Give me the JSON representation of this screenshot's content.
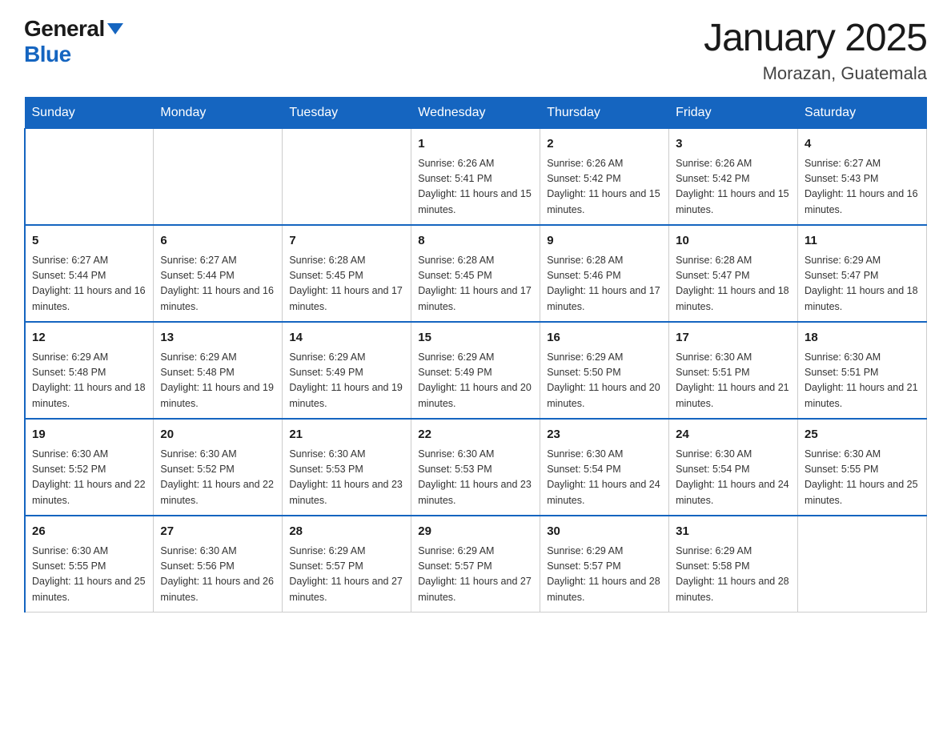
{
  "logo": {
    "general": "General",
    "blue": "Blue"
  },
  "title": "January 2025",
  "location": "Morazan, Guatemala",
  "days_of_week": [
    "Sunday",
    "Monday",
    "Tuesday",
    "Wednesday",
    "Thursday",
    "Friday",
    "Saturday"
  ],
  "weeks": [
    [
      {
        "day": "",
        "sunrise": "",
        "sunset": "",
        "daylight": ""
      },
      {
        "day": "",
        "sunrise": "",
        "sunset": "",
        "daylight": ""
      },
      {
        "day": "",
        "sunrise": "",
        "sunset": "",
        "daylight": ""
      },
      {
        "day": "1",
        "sunrise": "Sunrise: 6:26 AM",
        "sunset": "Sunset: 5:41 PM",
        "daylight": "Daylight: 11 hours and 15 minutes."
      },
      {
        "day": "2",
        "sunrise": "Sunrise: 6:26 AM",
        "sunset": "Sunset: 5:42 PM",
        "daylight": "Daylight: 11 hours and 15 minutes."
      },
      {
        "day": "3",
        "sunrise": "Sunrise: 6:26 AM",
        "sunset": "Sunset: 5:42 PM",
        "daylight": "Daylight: 11 hours and 15 minutes."
      },
      {
        "day": "4",
        "sunrise": "Sunrise: 6:27 AM",
        "sunset": "Sunset: 5:43 PM",
        "daylight": "Daylight: 11 hours and 16 minutes."
      }
    ],
    [
      {
        "day": "5",
        "sunrise": "Sunrise: 6:27 AM",
        "sunset": "Sunset: 5:44 PM",
        "daylight": "Daylight: 11 hours and 16 minutes."
      },
      {
        "day": "6",
        "sunrise": "Sunrise: 6:27 AM",
        "sunset": "Sunset: 5:44 PM",
        "daylight": "Daylight: 11 hours and 16 minutes."
      },
      {
        "day": "7",
        "sunrise": "Sunrise: 6:28 AM",
        "sunset": "Sunset: 5:45 PM",
        "daylight": "Daylight: 11 hours and 17 minutes."
      },
      {
        "day": "8",
        "sunrise": "Sunrise: 6:28 AM",
        "sunset": "Sunset: 5:45 PM",
        "daylight": "Daylight: 11 hours and 17 minutes."
      },
      {
        "day": "9",
        "sunrise": "Sunrise: 6:28 AM",
        "sunset": "Sunset: 5:46 PM",
        "daylight": "Daylight: 11 hours and 17 minutes."
      },
      {
        "day": "10",
        "sunrise": "Sunrise: 6:28 AM",
        "sunset": "Sunset: 5:47 PM",
        "daylight": "Daylight: 11 hours and 18 minutes."
      },
      {
        "day": "11",
        "sunrise": "Sunrise: 6:29 AM",
        "sunset": "Sunset: 5:47 PM",
        "daylight": "Daylight: 11 hours and 18 minutes."
      }
    ],
    [
      {
        "day": "12",
        "sunrise": "Sunrise: 6:29 AM",
        "sunset": "Sunset: 5:48 PM",
        "daylight": "Daylight: 11 hours and 18 minutes."
      },
      {
        "day": "13",
        "sunrise": "Sunrise: 6:29 AM",
        "sunset": "Sunset: 5:48 PM",
        "daylight": "Daylight: 11 hours and 19 minutes."
      },
      {
        "day": "14",
        "sunrise": "Sunrise: 6:29 AM",
        "sunset": "Sunset: 5:49 PM",
        "daylight": "Daylight: 11 hours and 19 minutes."
      },
      {
        "day": "15",
        "sunrise": "Sunrise: 6:29 AM",
        "sunset": "Sunset: 5:49 PM",
        "daylight": "Daylight: 11 hours and 20 minutes."
      },
      {
        "day": "16",
        "sunrise": "Sunrise: 6:29 AM",
        "sunset": "Sunset: 5:50 PM",
        "daylight": "Daylight: 11 hours and 20 minutes."
      },
      {
        "day": "17",
        "sunrise": "Sunrise: 6:30 AM",
        "sunset": "Sunset: 5:51 PM",
        "daylight": "Daylight: 11 hours and 21 minutes."
      },
      {
        "day": "18",
        "sunrise": "Sunrise: 6:30 AM",
        "sunset": "Sunset: 5:51 PM",
        "daylight": "Daylight: 11 hours and 21 minutes."
      }
    ],
    [
      {
        "day": "19",
        "sunrise": "Sunrise: 6:30 AM",
        "sunset": "Sunset: 5:52 PM",
        "daylight": "Daylight: 11 hours and 22 minutes."
      },
      {
        "day": "20",
        "sunrise": "Sunrise: 6:30 AM",
        "sunset": "Sunset: 5:52 PM",
        "daylight": "Daylight: 11 hours and 22 minutes."
      },
      {
        "day": "21",
        "sunrise": "Sunrise: 6:30 AM",
        "sunset": "Sunset: 5:53 PM",
        "daylight": "Daylight: 11 hours and 23 minutes."
      },
      {
        "day": "22",
        "sunrise": "Sunrise: 6:30 AM",
        "sunset": "Sunset: 5:53 PM",
        "daylight": "Daylight: 11 hours and 23 minutes."
      },
      {
        "day": "23",
        "sunrise": "Sunrise: 6:30 AM",
        "sunset": "Sunset: 5:54 PM",
        "daylight": "Daylight: 11 hours and 24 minutes."
      },
      {
        "day": "24",
        "sunrise": "Sunrise: 6:30 AM",
        "sunset": "Sunset: 5:54 PM",
        "daylight": "Daylight: 11 hours and 24 minutes."
      },
      {
        "day": "25",
        "sunrise": "Sunrise: 6:30 AM",
        "sunset": "Sunset: 5:55 PM",
        "daylight": "Daylight: 11 hours and 25 minutes."
      }
    ],
    [
      {
        "day": "26",
        "sunrise": "Sunrise: 6:30 AM",
        "sunset": "Sunset: 5:55 PM",
        "daylight": "Daylight: 11 hours and 25 minutes."
      },
      {
        "day": "27",
        "sunrise": "Sunrise: 6:30 AM",
        "sunset": "Sunset: 5:56 PM",
        "daylight": "Daylight: 11 hours and 26 minutes."
      },
      {
        "day": "28",
        "sunrise": "Sunrise: 6:29 AM",
        "sunset": "Sunset: 5:57 PM",
        "daylight": "Daylight: 11 hours and 27 minutes."
      },
      {
        "day": "29",
        "sunrise": "Sunrise: 6:29 AM",
        "sunset": "Sunset: 5:57 PM",
        "daylight": "Daylight: 11 hours and 27 minutes."
      },
      {
        "day": "30",
        "sunrise": "Sunrise: 6:29 AM",
        "sunset": "Sunset: 5:57 PM",
        "daylight": "Daylight: 11 hours and 28 minutes."
      },
      {
        "day": "31",
        "sunrise": "Sunrise: 6:29 AM",
        "sunset": "Sunset: 5:58 PM",
        "daylight": "Daylight: 11 hours and 28 minutes."
      },
      {
        "day": "",
        "sunrise": "",
        "sunset": "",
        "daylight": ""
      }
    ]
  ]
}
